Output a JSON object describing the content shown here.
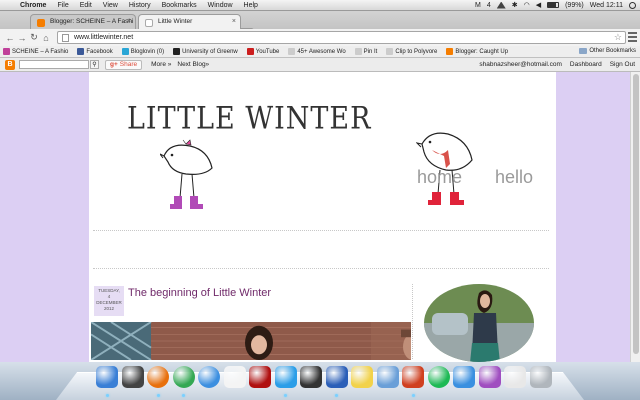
{
  "menubar": {
    "app": "Chrome",
    "menus": [
      "File",
      "Edit",
      "View",
      "History",
      "Bookmarks",
      "Window",
      "Help"
    ],
    "status_initial": "M",
    "status_num": "4",
    "battery": "(99%)",
    "clock": "Wed 12:11"
  },
  "tabs": [
    {
      "label": "Blogger: SCHEINE – A Fashi",
      "favicon": "blogger-icon",
      "color": "#f57d00",
      "active": false
    },
    {
      "label": "Little Winter",
      "favicon": "page-icon",
      "color": "#d0d0d0",
      "active": true
    }
  ],
  "toolbar": {
    "url": "www.littlewinter.net"
  },
  "bookmarks": {
    "items": [
      {
        "label": "SCHEINE – A Fashio",
        "icon": "scheine-icon",
        "color": "#c0409a"
      },
      {
        "label": "Facebook",
        "icon": "facebook-icon",
        "color": "#3b5998"
      },
      {
        "label": "Bloglovin (0)",
        "icon": "bloglovin-icon",
        "color": "#2aa6d6"
      },
      {
        "label": "University of Greenw",
        "icon": "university-icon",
        "color": "#222222"
      },
      {
        "label": "YouTube",
        "icon": "youtube-icon",
        "color": "#cc1e1e"
      },
      {
        "label": "45+ Awesome Wo",
        "icon": "page-icon",
        "color": "#bbbbbb"
      },
      {
        "label": "Pin It",
        "icon": "page-icon",
        "color": "#bbbbbb"
      },
      {
        "label": "Clip to Polyvore",
        "icon": "page-icon",
        "color": "#bbbbbb"
      },
      {
        "label": "Blogger: Caught Up",
        "icon": "blogger-icon",
        "color": "#f57d00"
      }
    ],
    "other": "Other Bookmarks"
  },
  "navbar": {
    "logo": "B",
    "share": "Share",
    "more": "More »",
    "next_blog": "Next Blog»",
    "email": "shabnazsheer@hotmail.com",
    "dashboard": "Dashboard",
    "signout": "Sign Out"
  },
  "blog": {
    "title": "LITTLE WINTER",
    "menu": [
      "home",
      "hello"
    ],
    "post": {
      "day": "TUESDAY,",
      "date_num": "4",
      "month": "DECEMBER",
      "year": "2012",
      "title": "The beginning of Little Winter"
    }
  },
  "dock": [
    {
      "name": "finder-icon",
      "color": "#3a7fd6"
    },
    {
      "name": "dashboard-icon",
      "color": "#444444"
    },
    {
      "name": "firefox-icon",
      "color": "#e8700c"
    },
    {
      "name": "chrome-icon",
      "color": "#34a853"
    },
    {
      "name": "itunes-icon",
      "color": "#3c8fe0"
    },
    {
      "name": "ical-icon",
      "color": "#f4f4f4"
    },
    {
      "name": "photo-booth-icon",
      "color": "#b01010"
    },
    {
      "name": "tweetdeck-icon",
      "color": "#2b9ee8"
    },
    {
      "name": "camera-icon",
      "color": "#333333"
    },
    {
      "name": "word-icon",
      "color": "#2b5fb8"
    },
    {
      "name": "stickies-icon",
      "color": "#f2d24a"
    },
    {
      "name": "preview-icon",
      "color": "#6a9fd8"
    },
    {
      "name": "remote-desktop-icon",
      "color": "#d04020"
    },
    {
      "name": "spotify-icon",
      "color": "#1db954"
    },
    {
      "name": "dropbox-icon",
      "color": "#3a90e0"
    },
    {
      "name": "itunes-store-icon",
      "color": "#a04ec0"
    },
    {
      "name": "mail-icon",
      "color": "#e8e8e8"
    },
    {
      "name": "trash-icon",
      "color": "#b0b6bc"
    }
  ]
}
